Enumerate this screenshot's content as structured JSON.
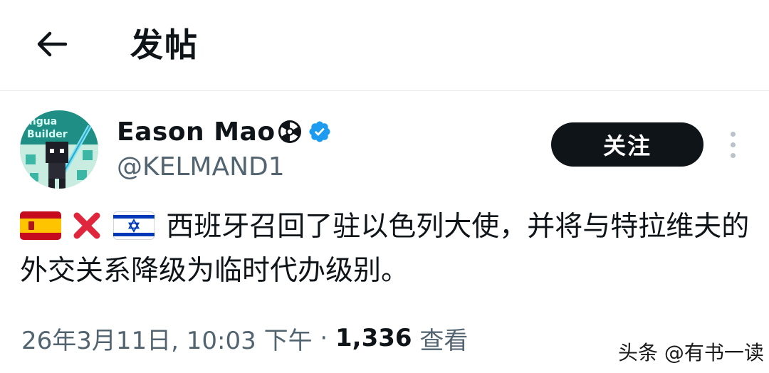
{
  "header": {
    "title": "发帖",
    "back_icon": "arrow-left-icon"
  },
  "author": {
    "display_name": "Eason Mao",
    "name_emoji": "radioactive-icon",
    "verified": true,
    "verified_color": "#1d9bf0",
    "handle": "@KELMAND1",
    "avatar_text_line1": "ingua",
    "avatar_text_line2": "Builder"
  },
  "follow_button": {
    "label": "关注"
  },
  "tweet": {
    "emojis": [
      "spain-flag-icon",
      "red-cross-icon",
      "israel-flag-icon"
    ],
    "text": "西班牙召回了驻以色列大使，并将与特拉维夫的外交关系降级为临时代办级别。"
  },
  "meta": {
    "date": "26年3月11日, 10:03 下午",
    "separator": " · ",
    "views_count": "1,336",
    "views_label": " 查看"
  },
  "watermark": "头条 @有书一读",
  "colors": {
    "text": "#0f1419",
    "secondary": "#536471",
    "follow_bg": "#0f1419",
    "divider": "#e6e8ea"
  }
}
